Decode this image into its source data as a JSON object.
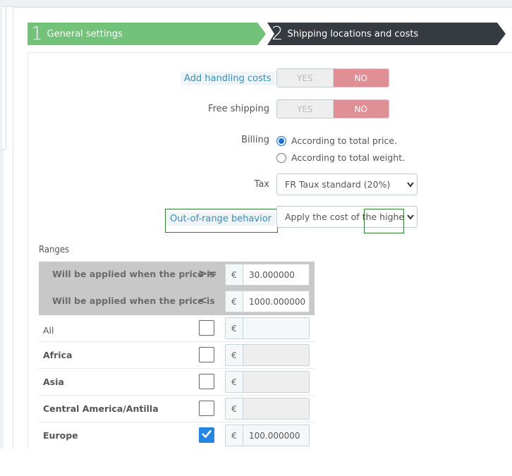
{
  "steps": [
    {
      "number": "1",
      "label": "General settings"
    },
    {
      "number": "2",
      "label": "Shipping locations and costs"
    }
  ],
  "form": {
    "handling": {
      "label": "Add handling costs",
      "yes": "YES",
      "no": "NO"
    },
    "free_shipping": {
      "label": "Free shipping",
      "yes": "YES",
      "no": "NO"
    },
    "billing": {
      "label": "Billing",
      "options": [
        "According to total price.",
        "According to total weight."
      ],
      "selected": "According to total price."
    },
    "tax": {
      "label": "Tax",
      "value": "FR Taux standard (20%)"
    },
    "out_of_range": {
      "label": "Out-of-range behavior",
      "value": "Apply the cost of the highest"
    }
  },
  "ranges": {
    "title": "Ranges",
    "rows_head": [
      {
        "text": "Will be applied when the price is",
        "operator": ">=",
        "currency": "€",
        "value": "30.000000"
      },
      {
        "text": "Will be applied when the price is",
        "operator": "<",
        "currency": "€",
        "value": "1000.000000"
      }
    ],
    "zones": [
      {
        "name": "All",
        "checked": false,
        "currency": "€",
        "value": ""
      },
      {
        "name": "Africa",
        "checked": false,
        "currency": "€",
        "value": ""
      },
      {
        "name": "Asia",
        "checked": false,
        "currency": "€",
        "value": ""
      },
      {
        "name": "Central America/Antilla",
        "checked": false,
        "currency": "€",
        "value": ""
      },
      {
        "name": "Europe",
        "checked": true,
        "currency": "€",
        "value": "100.000000"
      }
    ]
  },
  "icons": {
    "checkmark": "check-icon",
    "select_arrow": "chevron-down-icon"
  },
  "colors": {
    "step_done": "#72c279",
    "step_current": "#363a41",
    "toggle_no": "#e08f95",
    "checkbox_on": "#2585e0",
    "highlight_box": "#2e7d32"
  }
}
